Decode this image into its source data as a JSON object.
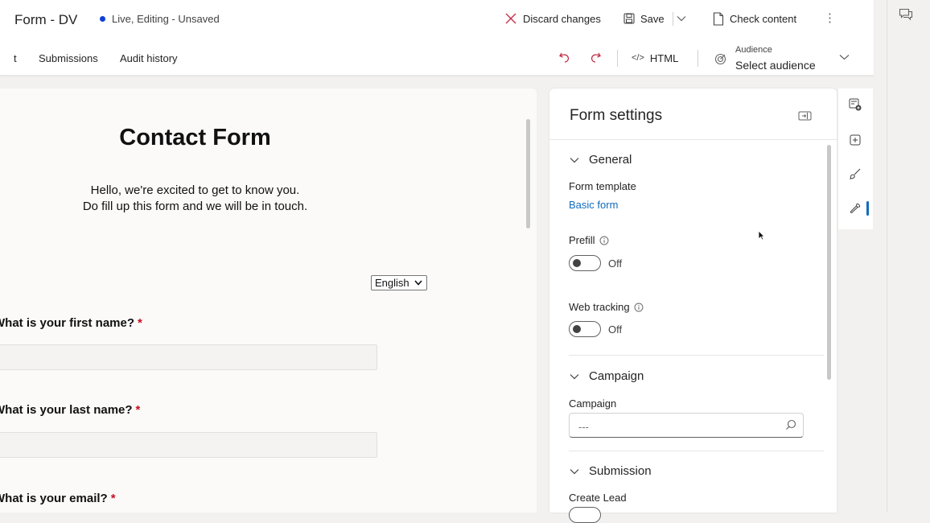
{
  "header": {
    "title": "Form - DV",
    "status": "Live, Editing - Unsaved",
    "discard_label": "Discard changes",
    "save_label": "Save",
    "check_label": "Check content",
    "more_label": "⋮"
  },
  "tabs": [
    {
      "label": "t"
    },
    {
      "label": "Submissions"
    },
    {
      "label": "Audit history"
    }
  ],
  "toolbar": {
    "html_label": "HTML",
    "audience_label": "Audience",
    "audience_value": "Select audience"
  },
  "form": {
    "title": "Contact Form",
    "intro_line1": "Hello, we're excited to get to know you.",
    "intro_line2": "Do fill up this form and we will be in touch.",
    "language": "English",
    "questions": [
      {
        "label": "What is your first name?",
        "required": "*"
      },
      {
        "label": "What is your last name?",
        "required": "*"
      },
      {
        "label": "What is your email?",
        "required": "*"
      }
    ]
  },
  "settings": {
    "title": "Form settings",
    "general": {
      "heading": "General",
      "template_label": "Form template",
      "template_value": "Basic form",
      "prefill_label": "Prefill",
      "prefill_value": "Off",
      "tracking_label": "Web tracking",
      "tracking_value": "Off"
    },
    "campaign": {
      "heading": "Campaign",
      "field_label": "Campaign",
      "placeholder": "---"
    },
    "submission": {
      "heading": "Submission",
      "create_lead_label": "Create Lead"
    }
  },
  "colors": {
    "accent": "#0f6cbd",
    "status_dot": "#0f3fd6",
    "required": "#c50f1f"
  },
  "icons": [
    "dismiss-icon",
    "save-icon",
    "chevron-down-icon",
    "document-check-icon",
    "more-icon",
    "undo-icon",
    "redo-icon",
    "code-icon",
    "audience-icon",
    "feedback-icon",
    "add-section-icon",
    "add-element-icon",
    "brush-icon",
    "settings-wrench-icon",
    "collapse-panel-icon",
    "info-icon",
    "search-icon"
  ]
}
